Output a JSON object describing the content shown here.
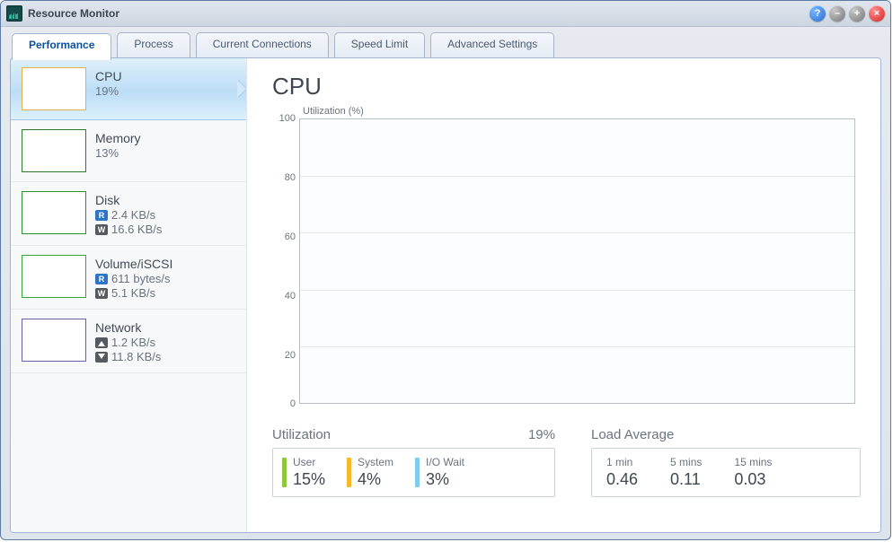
{
  "window": {
    "title": "Resource Monitor"
  },
  "tabs": [
    {
      "label": "Performance"
    },
    {
      "label": "Process"
    },
    {
      "label": "Current Connections"
    },
    {
      "label": "Speed Limit"
    },
    {
      "label": "Advanced Settings"
    }
  ],
  "sidebar": {
    "items": [
      {
        "title": "CPU",
        "sub1": "19%"
      },
      {
        "title": "Memory",
        "sub1": "13%"
      },
      {
        "title": "Disk",
        "r": "2.4 KB/s",
        "w": "16.6 KB/s"
      },
      {
        "title": "Volume/iSCSI",
        "r": "611 bytes/s",
        "w": "5.1 KB/s"
      },
      {
        "title": "Network",
        "up": "1.2 KB/s",
        "down": "11.8 KB/s"
      }
    ]
  },
  "main": {
    "heading": "CPU",
    "chart_ylabel": "Utilization (%)",
    "utilization_label": "Utilization",
    "utilization_total": "19%",
    "load_label": "Load Average",
    "stats": {
      "user": {
        "label": "User",
        "value": "15%"
      },
      "system": {
        "label": "System",
        "value": "4%"
      },
      "io": {
        "label": "I/O Wait",
        "value": "3%"
      }
    },
    "load": {
      "m1": {
        "label": "1 min",
        "value": "0.46"
      },
      "m5": {
        "label": "5 mins",
        "value": "0.11"
      },
      "m15": {
        "label": "15 mins",
        "value": "0.03"
      }
    }
  },
  "chart_data": {
    "type": "line",
    "ylabel": "Utilization (%)",
    "ylim": [
      0,
      100
    ],
    "yticks": [
      0,
      20,
      40,
      60,
      80,
      100
    ],
    "series": [
      {
        "name": "User",
        "color": "#8FC63D",
        "values": []
      },
      {
        "name": "System",
        "color": "#F6B92B",
        "values": []
      },
      {
        "name": "I/O Wait",
        "color": "#7FCDEE",
        "values": []
      }
    ]
  }
}
